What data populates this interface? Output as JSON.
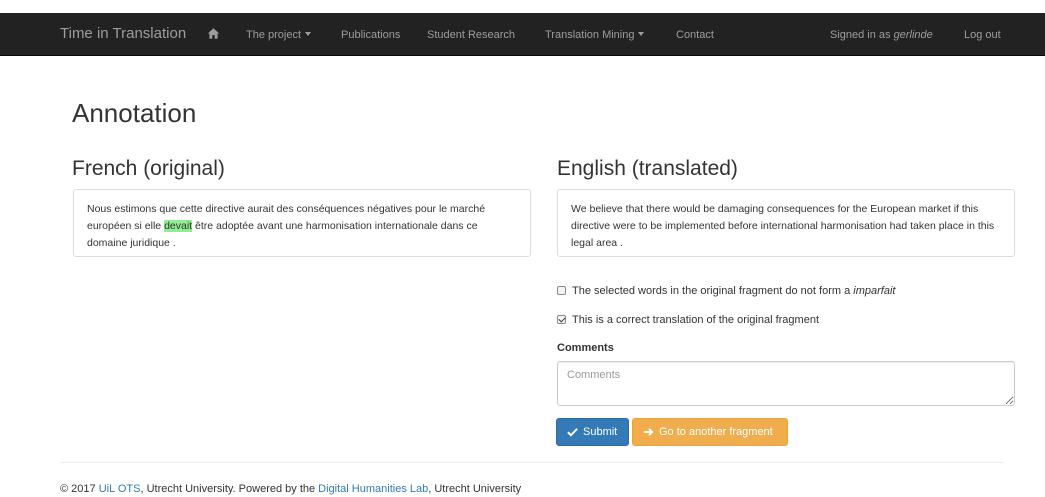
{
  "navbar": {
    "brand": "Time in Translation",
    "home_icon": "home-icon",
    "project": "The project",
    "publications": "Publications",
    "student_research": "Student Research",
    "translation_mining": "Translation Mining",
    "contact": "Contact",
    "signed_in_prefix": "Signed in as",
    "username": "gerlinde",
    "logout": "Log out"
  },
  "page": {
    "title": "Annotation"
  },
  "original": {
    "heading": "French (original)",
    "text_before": "Nous estimons que cette directive aurait des conséquences négatives pour le marché européen si elle ",
    "highlight": "devait",
    "text_after": " être adoptée avant une harmonisation internationale dans ce domaine juridique ."
  },
  "translation": {
    "heading": "English (translated)",
    "text": "We believe that there would be damaging consequences for the European market if this directive were to be implemented before international harmonisation had taken place in this legal area ."
  },
  "form": {
    "check1_prefix": "The selected words in the original fragment do not form a",
    "check1_term": "imparfait",
    "check1_checked": false,
    "check2_label": "This is a correct translation of the original fragment",
    "check2_checked": true,
    "comments_label": "Comments",
    "comments_placeholder": "Comments",
    "submit_label": "Submit",
    "other_label": "Go to another fragment"
  },
  "footer": {
    "prefix": "© 2017 ",
    "link1": "UiL OTS",
    "middle": ", Utrecht University. Powered by the ",
    "link2": "Digital Humanities Lab",
    "suffix": ", Utrecht University"
  },
  "colors": {
    "navbar_bg": "#222222",
    "nav_text": "#9d9d9d",
    "primary": "#337ab7",
    "warning": "#f0ad4e",
    "highlight": "#90ee90"
  }
}
